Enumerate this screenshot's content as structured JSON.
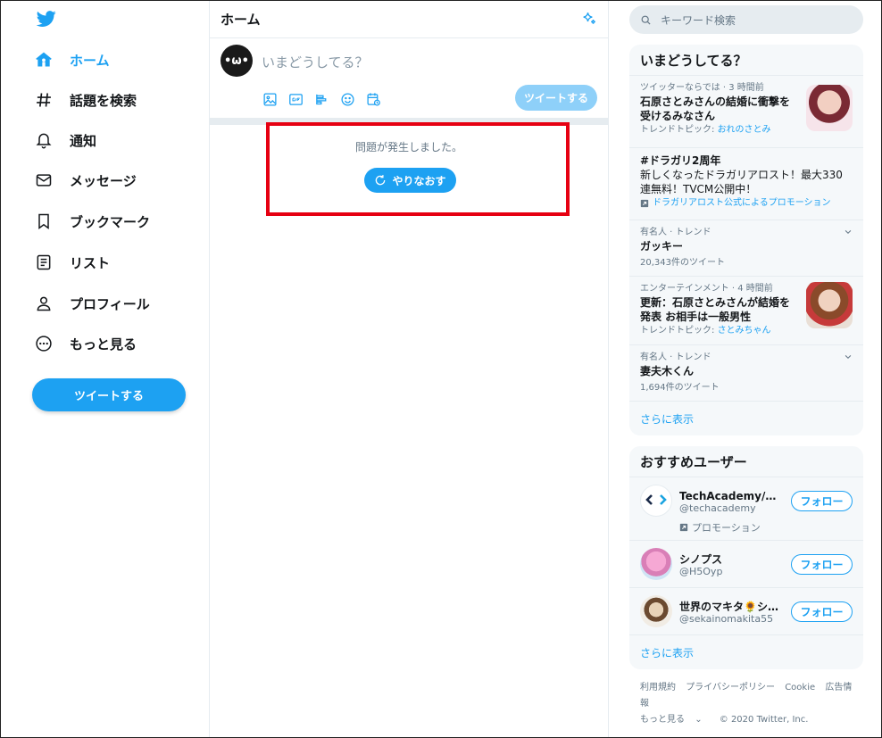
{
  "sidebar": {
    "logo_icon": "twitter-bird-icon",
    "items": [
      {
        "label": "ホーム",
        "icon": "home-icon"
      },
      {
        "label": "話題を検索",
        "icon": "hashtag-icon"
      },
      {
        "label": "通知",
        "icon": "bell-icon"
      },
      {
        "label": "メッセージ",
        "icon": "envelope-icon"
      },
      {
        "label": "ブックマーク",
        "icon": "bookmark-icon"
      },
      {
        "label": "リスト",
        "icon": "list-icon"
      },
      {
        "label": "プロフィール",
        "icon": "person-icon"
      },
      {
        "label": "もっと見る",
        "icon": "more-circle-icon"
      }
    ],
    "tweet_label": "ツイートする"
  },
  "main": {
    "title": "ホーム",
    "composer": {
      "avatar_text": "•ω•",
      "placeholder": "いまどうしてる？",
      "tools": [
        "image-icon",
        "gif-icon",
        "poll-icon",
        "emoji-icon",
        "schedule-icon"
      ],
      "tweet_label": "ツイートする"
    },
    "error": {
      "message": "問題が発生しました。",
      "retry_label": "やりなおす"
    }
  },
  "right": {
    "search_placeholder": "キーワード検索",
    "trends": {
      "title": "いまどうしてる？",
      "items": [
        {
          "meta": "ツイッターならでは · 3 時間前",
          "body": "石原さとみさんの結婚に衝撃を受けるみなさん",
          "topic_prefix": "トレンドトピック: ",
          "topic": "おれのさとみ"
        },
        {
          "meta": "#ドラガリ2周年",
          "body": "新しくなったドラガリアロスト！最大330連無料！TVCM公開中！",
          "promo": "ドラガリアロスト公式によるプロモーション"
        },
        {
          "meta": "有名人 · トレンド",
          "title": "ガッキー",
          "count": "20,343件のツイート"
        },
        {
          "meta": "エンターテインメント · 4 時間前",
          "body": "更新：石原さとみさんが結婚を発表 お相手は一般男性",
          "topic_prefix": "トレンドトピック: ",
          "topic": "さとみちゃん"
        },
        {
          "meta": "有名人 · トレンド",
          "title": "妻夫木くん",
          "count": "1,694件のツイート"
        }
      ],
      "more_label": "さらに表示"
    },
    "who_to_follow": {
      "title": "おすすめユーザー",
      "users": [
        {
          "name": "TechAcademy/テックアカデミー",
          "handle": "@techacademy",
          "promo": "プロモーション",
          "follow_label": "フォロー"
        },
        {
          "name": "シノプス",
          "handle": "@H5Oyp",
          "follow_label": "フォロー"
        },
        {
          "name": "世界のマキタ🌻シェフ",
          "handle": "@sekainomakita55",
          "follow_label": "フォロー"
        }
      ],
      "more_label": "さらに表示"
    },
    "footer": {
      "links": [
        "利用規約",
        "プライバシーポリシー",
        "Cookie",
        "広告情報"
      ],
      "more": "もっと見る",
      "copyright": "© 2020 Twitter, Inc."
    }
  },
  "colors": {
    "accent": "#1da1f2",
    "accent_disabled": "#8ed0f9",
    "highlight": "#e60012",
    "muted": "#657786"
  }
}
